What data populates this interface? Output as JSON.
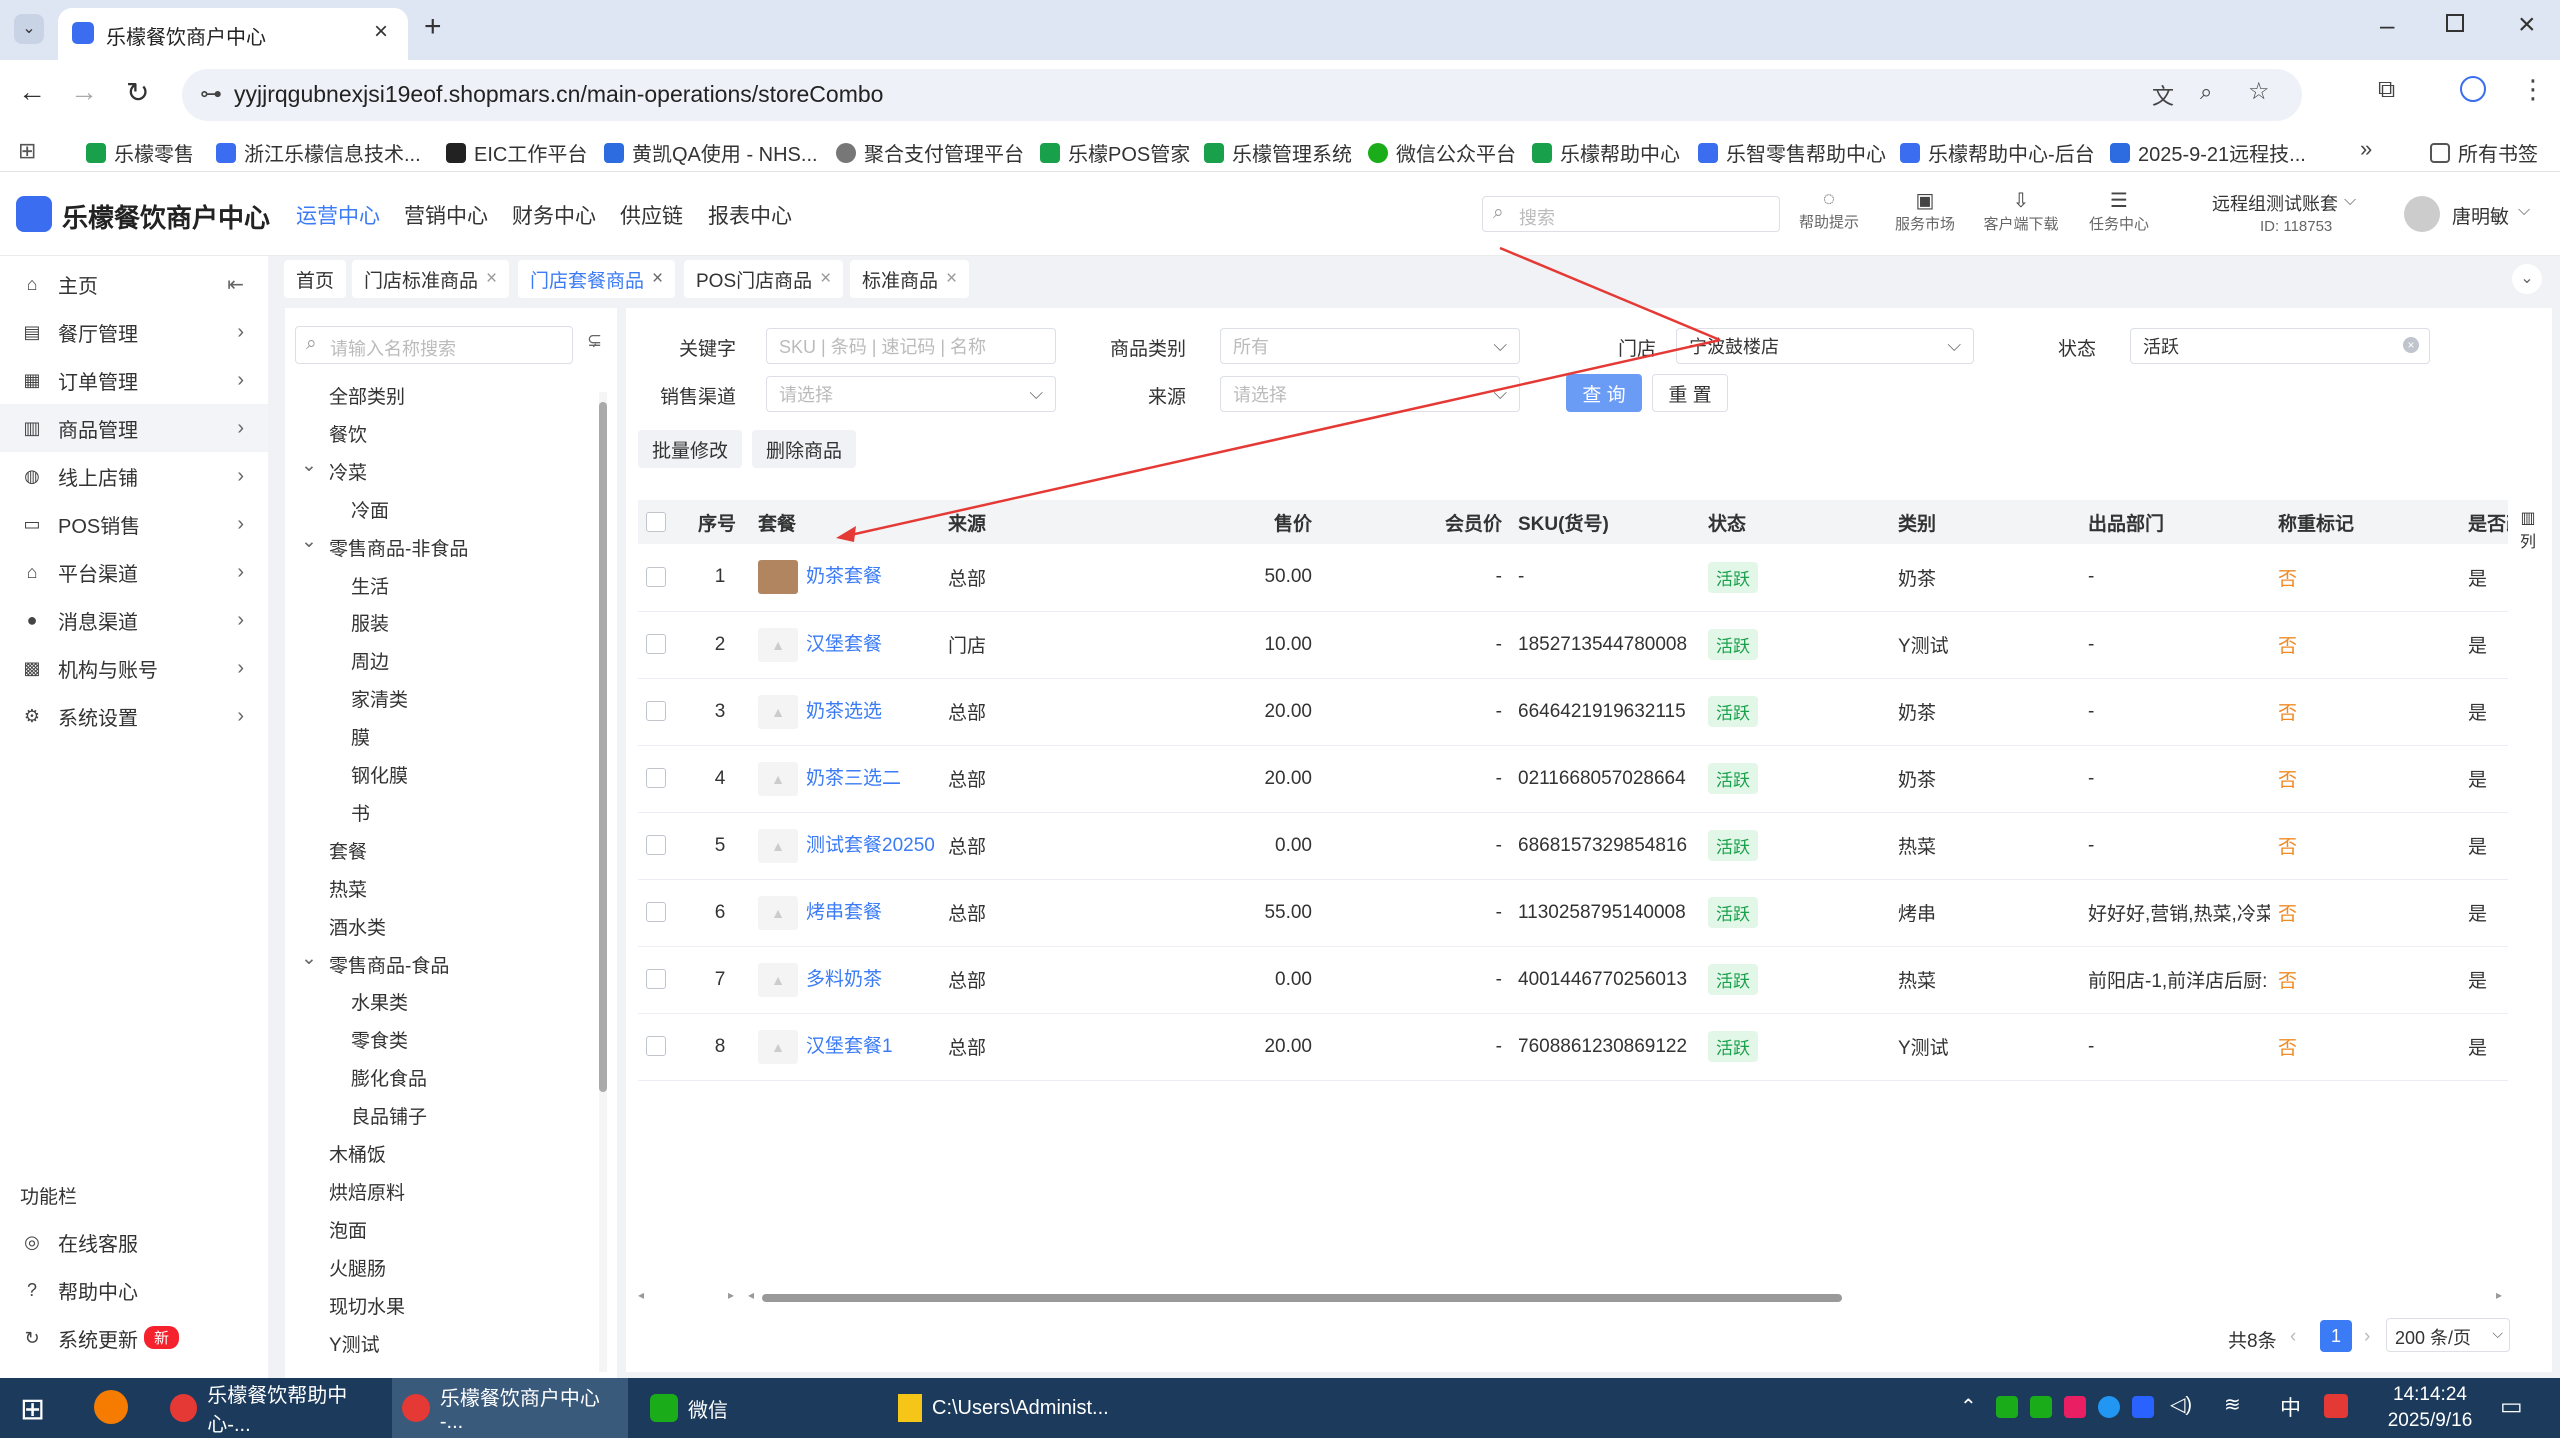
{
  "browser": {
    "tab_title": "乐檬餐饮商户中心",
    "url": "yyjjrqgubnexjsi19eof.shopmars.cn/main-operations/storeCombo",
    "bookmarks": [
      "乐檬零售",
      "浙江乐檬信息技术...",
      "EIC工作平台",
      "黄凯QA使用 - NHS...",
      "聚合支付管理平台",
      "乐檬POS管家",
      "乐檬管理系统",
      "微信公众平台",
      "乐檬帮助中心",
      "乐智零售帮助中心",
      "乐檬帮助中心-后台",
      "2025-9-21远程技..."
    ],
    "bookmarks_folder": "所有书签"
  },
  "app": {
    "logo_text": "乐檬餐饮商户中心",
    "nav": [
      "运营中心",
      "营销中心",
      "财务中心",
      "供应链",
      "报表中心"
    ],
    "search_placeholder": "搜索",
    "header_icons": [
      "帮助提示",
      "服务市场",
      "客户端下载",
      "任务中心"
    ],
    "account_name": "远程组测试账套",
    "account_id": "ID: 118753",
    "user_name": "唐明敏"
  },
  "sidebar": {
    "items": [
      "主页",
      "餐厅管理",
      "订单管理",
      "商品管理",
      "线上店铺",
      "POS销售",
      "平台渠道",
      "消息渠道",
      "机构与账号",
      "系统设置"
    ],
    "func_title": "功能栏",
    "func_items": [
      "在线客服",
      "帮助中心",
      "系统更新"
    ],
    "new_badge": "新"
  },
  "page_tabs": [
    "首页",
    "门店标准商品",
    "门店套餐商品",
    "POS门店商品",
    "标准商品"
  ],
  "tree": {
    "search_placeholder": "请输入名称搜索",
    "nodes": [
      {
        "label": "全部类别",
        "level": 0
      },
      {
        "label": "餐饮",
        "level": 0
      },
      {
        "label": "冷菜",
        "level": 0,
        "arrow": true
      },
      {
        "label": "冷面",
        "level": 1
      },
      {
        "label": "零售商品-非食品",
        "level": 0,
        "arrow": true
      },
      {
        "label": "生活",
        "level": 1
      },
      {
        "label": "服装",
        "level": 1
      },
      {
        "label": "周边",
        "level": 1
      },
      {
        "label": "家清类",
        "level": 1
      },
      {
        "label": "膜",
        "level": 1
      },
      {
        "label": "钢化膜",
        "level": 1
      },
      {
        "label": "书",
        "level": 1
      },
      {
        "label": "套餐",
        "level": 0
      },
      {
        "label": "热菜",
        "level": 0
      },
      {
        "label": "酒水类",
        "level": 0
      },
      {
        "label": "零售商品-食品",
        "level": 0,
        "arrow": true
      },
      {
        "label": "水果类",
        "level": 1
      },
      {
        "label": "零食类",
        "level": 1
      },
      {
        "label": "膨化食品",
        "level": 1
      },
      {
        "label": "良品铺子",
        "level": 1
      },
      {
        "label": "木桶饭",
        "level": 0
      },
      {
        "label": "烘焙原料",
        "level": 0
      },
      {
        "label": "泡面",
        "level": 0
      },
      {
        "label": "火腿肠",
        "level": 0
      },
      {
        "label": "现切水果",
        "level": 0
      },
      {
        "label": "Y测试",
        "level": 0
      }
    ]
  },
  "filters": {
    "keyword_label": "关键字",
    "keyword_placeholder": "SKU | 条码 | 速记码 | 名称",
    "category_label": "商品类别",
    "category_value": "所有",
    "store_label": "门店",
    "store_value": "宁波鼓楼店",
    "status_label": "状态",
    "status_value": "活跃",
    "channel_label": "销售渠道",
    "channel_placeholder": "请选择",
    "source_label": "来源",
    "source_placeholder": "请选择",
    "query_btn": "查 询",
    "reset_btn": "重 置",
    "batch_btn": "批量修改",
    "delete_btn": "删除商品"
  },
  "table": {
    "columns": [
      "序号",
      "套餐",
      "来源",
      "售价",
      "会员价",
      "SKU(货号)",
      "状态",
      "类别",
      "出品部门",
      "称重标记",
      "是否改"
    ],
    "col_setting": "列",
    "rows": [
      {
        "no": "1",
        "name": "奶茶套餐",
        "source": "总部",
        "price": "50.00",
        "member": "-",
        "sku": "-",
        "status": "活跃",
        "cat": "奶茶",
        "dept": "-",
        "weigh": "否",
        "change": "是"
      },
      {
        "no": "2",
        "name": "汉堡套餐",
        "source": "门店",
        "price": "10.00",
        "member": "-",
        "sku": "1852713544780008",
        "status": "活跃",
        "cat": "Y测试",
        "dept": "-",
        "weigh": "否",
        "change": "是"
      },
      {
        "no": "3",
        "name": "奶茶选选",
        "source": "总部",
        "price": "20.00",
        "member": "-",
        "sku": "6646421919632115",
        "status": "活跃",
        "cat": "奶茶",
        "dept": "-",
        "weigh": "否",
        "change": "是"
      },
      {
        "no": "4",
        "name": "奶茶三选二",
        "source": "总部",
        "price": "20.00",
        "member": "-",
        "sku": "0211668057028664",
        "status": "活跃",
        "cat": "奶茶",
        "dept": "-",
        "weigh": "否",
        "change": "是"
      },
      {
        "no": "5",
        "name": "测试套餐20250",
        "source": "总部",
        "price": "0.00",
        "member": "-",
        "sku": "6868157329854816",
        "status": "活跃",
        "cat": "热菜",
        "dept": "-",
        "weigh": "否",
        "change": "是"
      },
      {
        "no": "6",
        "name": "烤串套餐",
        "source": "总部",
        "price": "55.00",
        "member": "-",
        "sku": "1130258795140008",
        "status": "活跃",
        "cat": "烤串",
        "dept": "好好好,营销,热菜,冷菜",
        "weigh": "否",
        "change": "是"
      },
      {
        "no": "7",
        "name": "多料奶茶",
        "source": "总部",
        "price": "0.00",
        "member": "-",
        "sku": "4001446770256013",
        "status": "活跃",
        "cat": "热菜",
        "dept": "前阳店-1,前洋店后厨:",
        "weigh": "否",
        "change": "是"
      },
      {
        "no": "8",
        "name": "汉堡套餐1",
        "source": "总部",
        "price": "20.00",
        "member": "-",
        "sku": "7608861230869122",
        "status": "活跃",
        "cat": "Y测试",
        "dept": "-",
        "weigh": "否",
        "change": "是"
      }
    ]
  },
  "pagination": {
    "total": "共8条",
    "current": "1",
    "page_size": "200 条/页"
  },
  "taskbar": {
    "items": [
      "乐檬餐饮帮助中心-...",
      "乐檬餐饮商户中心 -...",
      "微信",
      "C:\\Users\\Administ..."
    ],
    "ime": "中",
    "time": "14:14:24",
    "date": "2025/9/16"
  }
}
